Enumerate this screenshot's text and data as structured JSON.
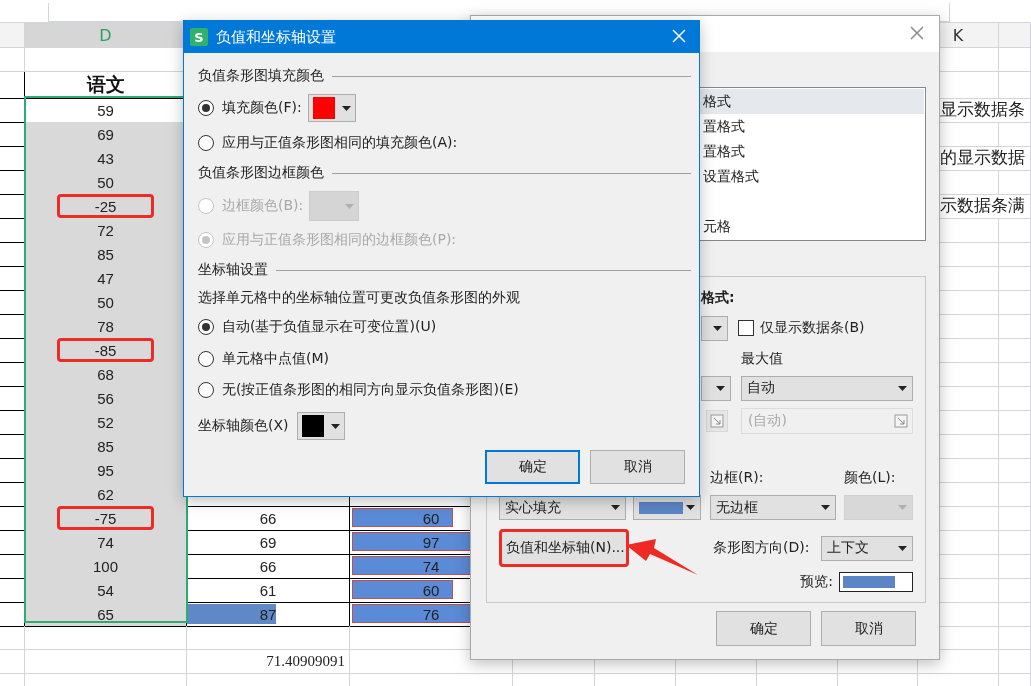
{
  "sheet": {
    "column_d_header": {
      "label": "D",
      "selected": true
    },
    "column_k_header": {
      "label": "K",
      "selected": false
    },
    "title_row": {
      "col_d": "语文"
    },
    "rows": [
      {
        "col_d": "59",
        "shaded": false,
        "highlighted": false,
        "col_k": "显示数据条"
      },
      {
        "col_d": "69",
        "shaded": true,
        "highlighted": false
      },
      {
        "col_d": "43",
        "shaded": true,
        "highlighted": false,
        "col_k": "的显示数据"
      },
      {
        "col_d": "50",
        "shaded": true,
        "highlighted": false
      },
      {
        "col_d": "-25",
        "shaded": true,
        "highlighted": true,
        "col_k": "示数据条满"
      },
      {
        "col_d": "72",
        "shaded": true,
        "highlighted": false
      },
      {
        "col_d": "85",
        "shaded": true,
        "highlighted": false
      },
      {
        "col_d": "47",
        "shaded": true,
        "highlighted": false
      },
      {
        "col_d": "50",
        "shaded": true,
        "highlighted": false
      },
      {
        "col_d": "78",
        "shaded": true,
        "highlighted": false
      },
      {
        "col_d": "-85",
        "shaded": true,
        "highlighted": true
      },
      {
        "col_d": "68",
        "shaded": true,
        "highlighted": false
      },
      {
        "col_d": "56",
        "shaded": true,
        "highlighted": false
      },
      {
        "col_d": "52",
        "shaded": true,
        "highlighted": false
      },
      {
        "col_d": "85",
        "shaded": true,
        "highlighted": false
      },
      {
        "col_d": "95",
        "shaded": true,
        "highlighted": false
      },
      {
        "col_d": "62",
        "shaded": true,
        "highlighted": false
      },
      {
        "col_d": "-75",
        "shaded": true,
        "highlighted": true,
        "col_e": {
          "text": "66"
        },
        "col_f": {
          "text": "60",
          "level": 0.65
        }
      },
      {
        "col_d": "74",
        "shaded": true,
        "highlighted": false,
        "col_e": {
          "text": "69"
        },
        "col_f": {
          "text": "97",
          "level": 0.95
        }
      },
      {
        "col_d": "100",
        "shaded": true,
        "highlighted": false,
        "col_e": {
          "text": "66"
        },
        "col_f": {
          "text": "74",
          "level": 0.8
        }
      },
      {
        "col_d": "54",
        "shaded": true,
        "highlighted": false,
        "col_e": {
          "text": "61"
        },
        "col_f": {
          "text": "60",
          "level": 0.65
        }
      },
      {
        "col_d": "65",
        "shaded": true,
        "highlighted": false,
        "col_e": {
          "text": "87",
          "level": 0.55
        },
        "col_f": {
          "text": "76",
          "level": 0.82
        }
      }
    ],
    "average_row": {
      "col_e": "71.40909091"
    }
  },
  "format_dialog": {
    "list_items": [
      {
        "label": "格式",
        "selected": true
      },
      {
        "label": "置格式",
        "selected": false
      },
      {
        "label": "置格式",
        "selected": false
      },
      {
        "label": "设置格式",
        "selected": false
      },
      {
        "selected": false
      },
      {
        "label": "元格",
        "selected": false
      }
    ],
    "style_label": "格式:",
    "only_bar_checkbox": {
      "label": "仅显示数据条(B)",
      "checked": false
    },
    "max_label": "最大值",
    "max_type": {
      "value": "自动"
    },
    "max_value": {
      "placeholder": "(自动)",
      "disabled": true
    },
    "border_label": "边框(R):",
    "color_label": "颜色(L):",
    "fill_type": {
      "value": "实心填充"
    },
    "fill_color": {
      "color": "#5b86c5"
    },
    "border_type": {
      "value": "无边框"
    },
    "border_color": {
      "disabled": true
    },
    "negative_button": {
      "label": "负值和坐标轴(N)...",
      "highlighted": true
    },
    "direction_label": "条形图方向(D):",
    "direction": {
      "value": "上下文"
    },
    "preview_label": "预览:",
    "buttons": [
      {
        "label": "确定"
      },
      {
        "label": "取消"
      }
    ]
  },
  "neg_dialog": {
    "app_logo": "S",
    "title": "负值和坐标轴设置",
    "fill_section": {
      "heading": "负值条形图填充颜色",
      "options": [
        {
          "kind": "color",
          "label": "填充颜色(F):",
          "selected": true,
          "disabled": false,
          "color": "#ff0000"
        },
        {
          "kind": "plain",
          "label": "应用与正值条形图相同的填充颜色(A):",
          "selected": false,
          "disabled": false
        }
      ]
    },
    "border_section": {
      "heading": "负值条形图边框颜色",
      "options": [
        {
          "kind": "color",
          "label": "边框颜色(B):",
          "selected": false,
          "disabled": true
        },
        {
          "kind": "plain",
          "label": "应用与正值条形图相同的边框颜色(P):",
          "selected": true,
          "disabled": true
        }
      ]
    },
    "axis_section": {
      "heading": "坐标轴设置",
      "description": "选择单元格中的坐标轴位置可更改负值条形图的外观",
      "options": [
        {
          "kind": "plain",
          "label": "自动(基于负值显示在可变位置)(U)",
          "selected": true,
          "disabled": false
        },
        {
          "kind": "plain",
          "label": "单元格中点值(M)",
          "selected": false,
          "disabled": false
        },
        {
          "kind": "plain",
          "label": "无(按正值条形图的相同方向显示负值条形图)(E)",
          "selected": false,
          "disabled": false
        }
      ],
      "axis_color": {
        "label": "坐标轴颜色(X)",
        "color": "#000000"
      }
    },
    "buttons": [
      {
        "label": "确定",
        "default": true
      },
      {
        "label": "取消",
        "default": false
      }
    ]
  }
}
